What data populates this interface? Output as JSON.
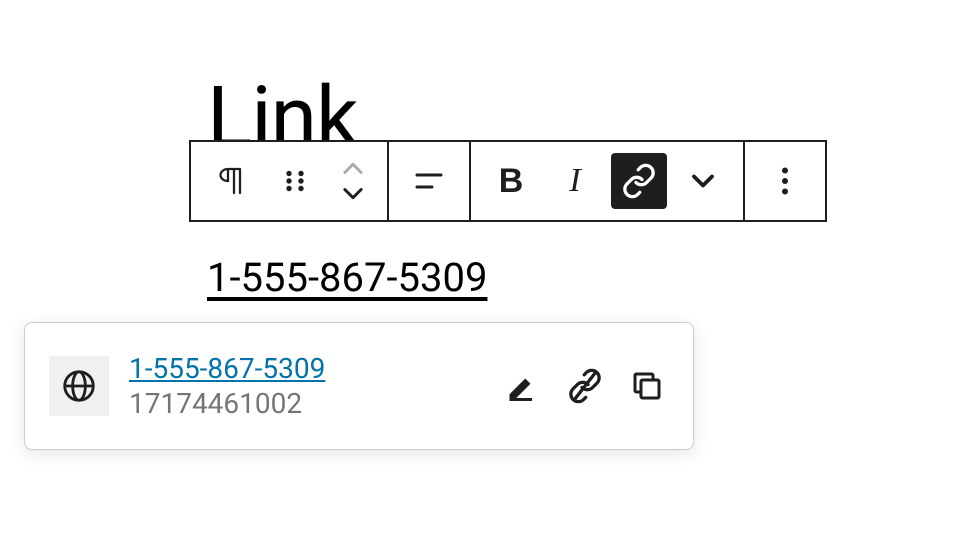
{
  "heading": "Link",
  "content": {
    "link_text": "1-555-867-5309"
  },
  "link_popover": {
    "title": "1-555-867-5309",
    "url_display": "17174461002"
  }
}
